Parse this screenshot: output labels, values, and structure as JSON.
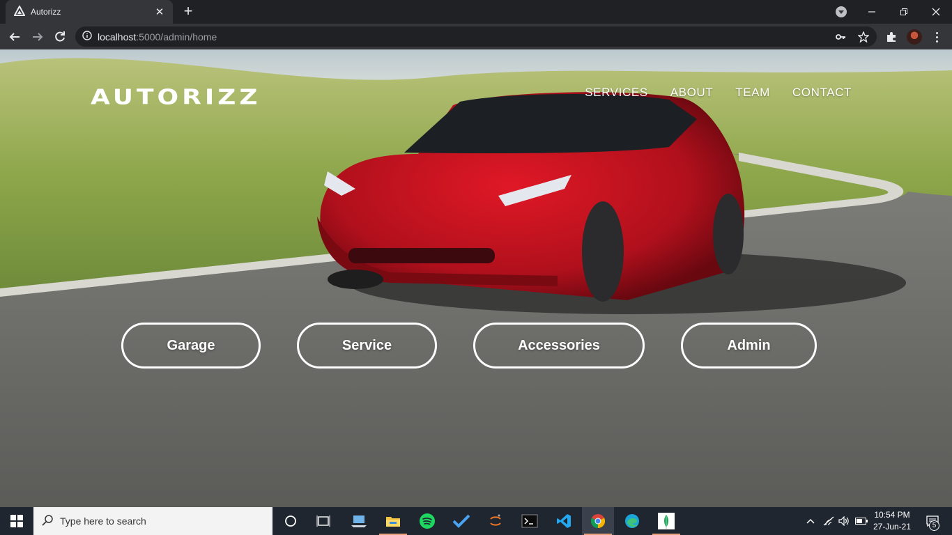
{
  "browser": {
    "tab_title": "Autorizz",
    "tab_close": "✕",
    "new_tab": "+",
    "url_host": "localhost",
    "url_path": ":5000/admin/home"
  },
  "site": {
    "logo": "AUTORIZZ",
    "nav": [
      "SERVICES",
      "ABOUT",
      "TEAM",
      "CONTACT"
    ],
    "buttons": [
      "Garage",
      "Service",
      "Accessories",
      "Admin"
    ]
  },
  "taskbar": {
    "search_placeholder": "Type here to search",
    "time": "10:54 PM",
    "date": "27-Jun-21",
    "notification_count": "5",
    "accent_color": "#e8a07a"
  }
}
